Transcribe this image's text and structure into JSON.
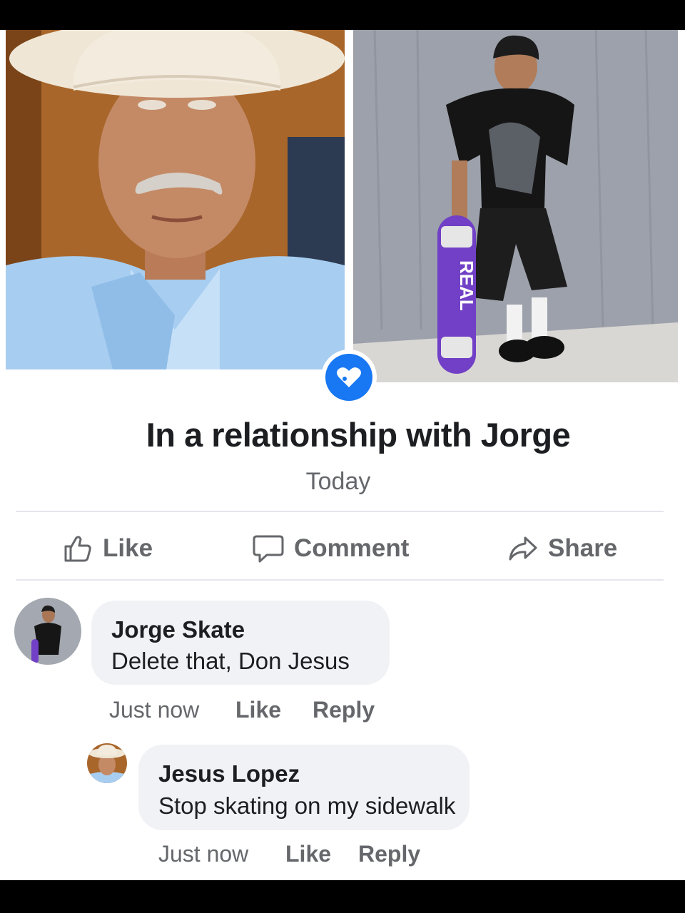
{
  "post": {
    "headline": "In a relationship with Jorge",
    "date": "Today"
  },
  "photos": {
    "skateboard_text": "REAL"
  },
  "actions": {
    "like": "Like",
    "comment": "Comment",
    "share": "Share"
  },
  "comments": [
    {
      "author": "Jorge Skate",
      "text": "Delete that, Don Jesus",
      "time": "Just now",
      "like": "Like",
      "reply": "Reply"
    },
    {
      "author": "Jesus Lopez",
      "text": "Stop skating on my sidewalk",
      "time": "Just now",
      "like": "Like",
      "reply": "Reply"
    }
  ],
  "colors": {
    "accent": "#1877f2",
    "text": "#1c1e21",
    "muted": "#65676b",
    "bubble": "#f0f2f5"
  }
}
